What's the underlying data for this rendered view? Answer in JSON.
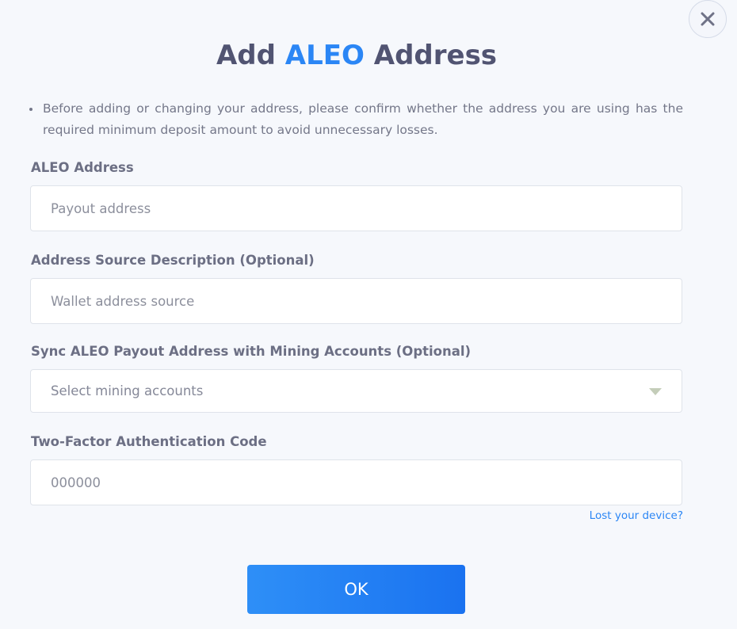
{
  "dialog": {
    "title_prefix": "Add",
    "title_accent": "ALEO",
    "title_suffix": "Address",
    "notice": "Before adding or changing your address, please confirm whether the address you are using has the required minimum deposit amount to avoid unnecessary losses.",
    "accent_color": "#2b86f5",
    "close_icon": "close-icon"
  },
  "form": {
    "address": {
      "label": "ALEO Address",
      "placeholder": "Payout address",
      "value": ""
    },
    "description": {
      "label": "Address Source Description (Optional)",
      "placeholder": "Wallet address source",
      "value": ""
    },
    "sync": {
      "label": "Sync ALEO Payout Address with Mining Accounts (Optional)",
      "placeholder": "Select mining accounts",
      "icon": "chevron-down-icon"
    },
    "two_factor": {
      "label": "Two-Factor Authentication Code",
      "placeholder": "000000",
      "value": "",
      "lost_link": "Lost your device?"
    },
    "ok_label": "OK"
  }
}
